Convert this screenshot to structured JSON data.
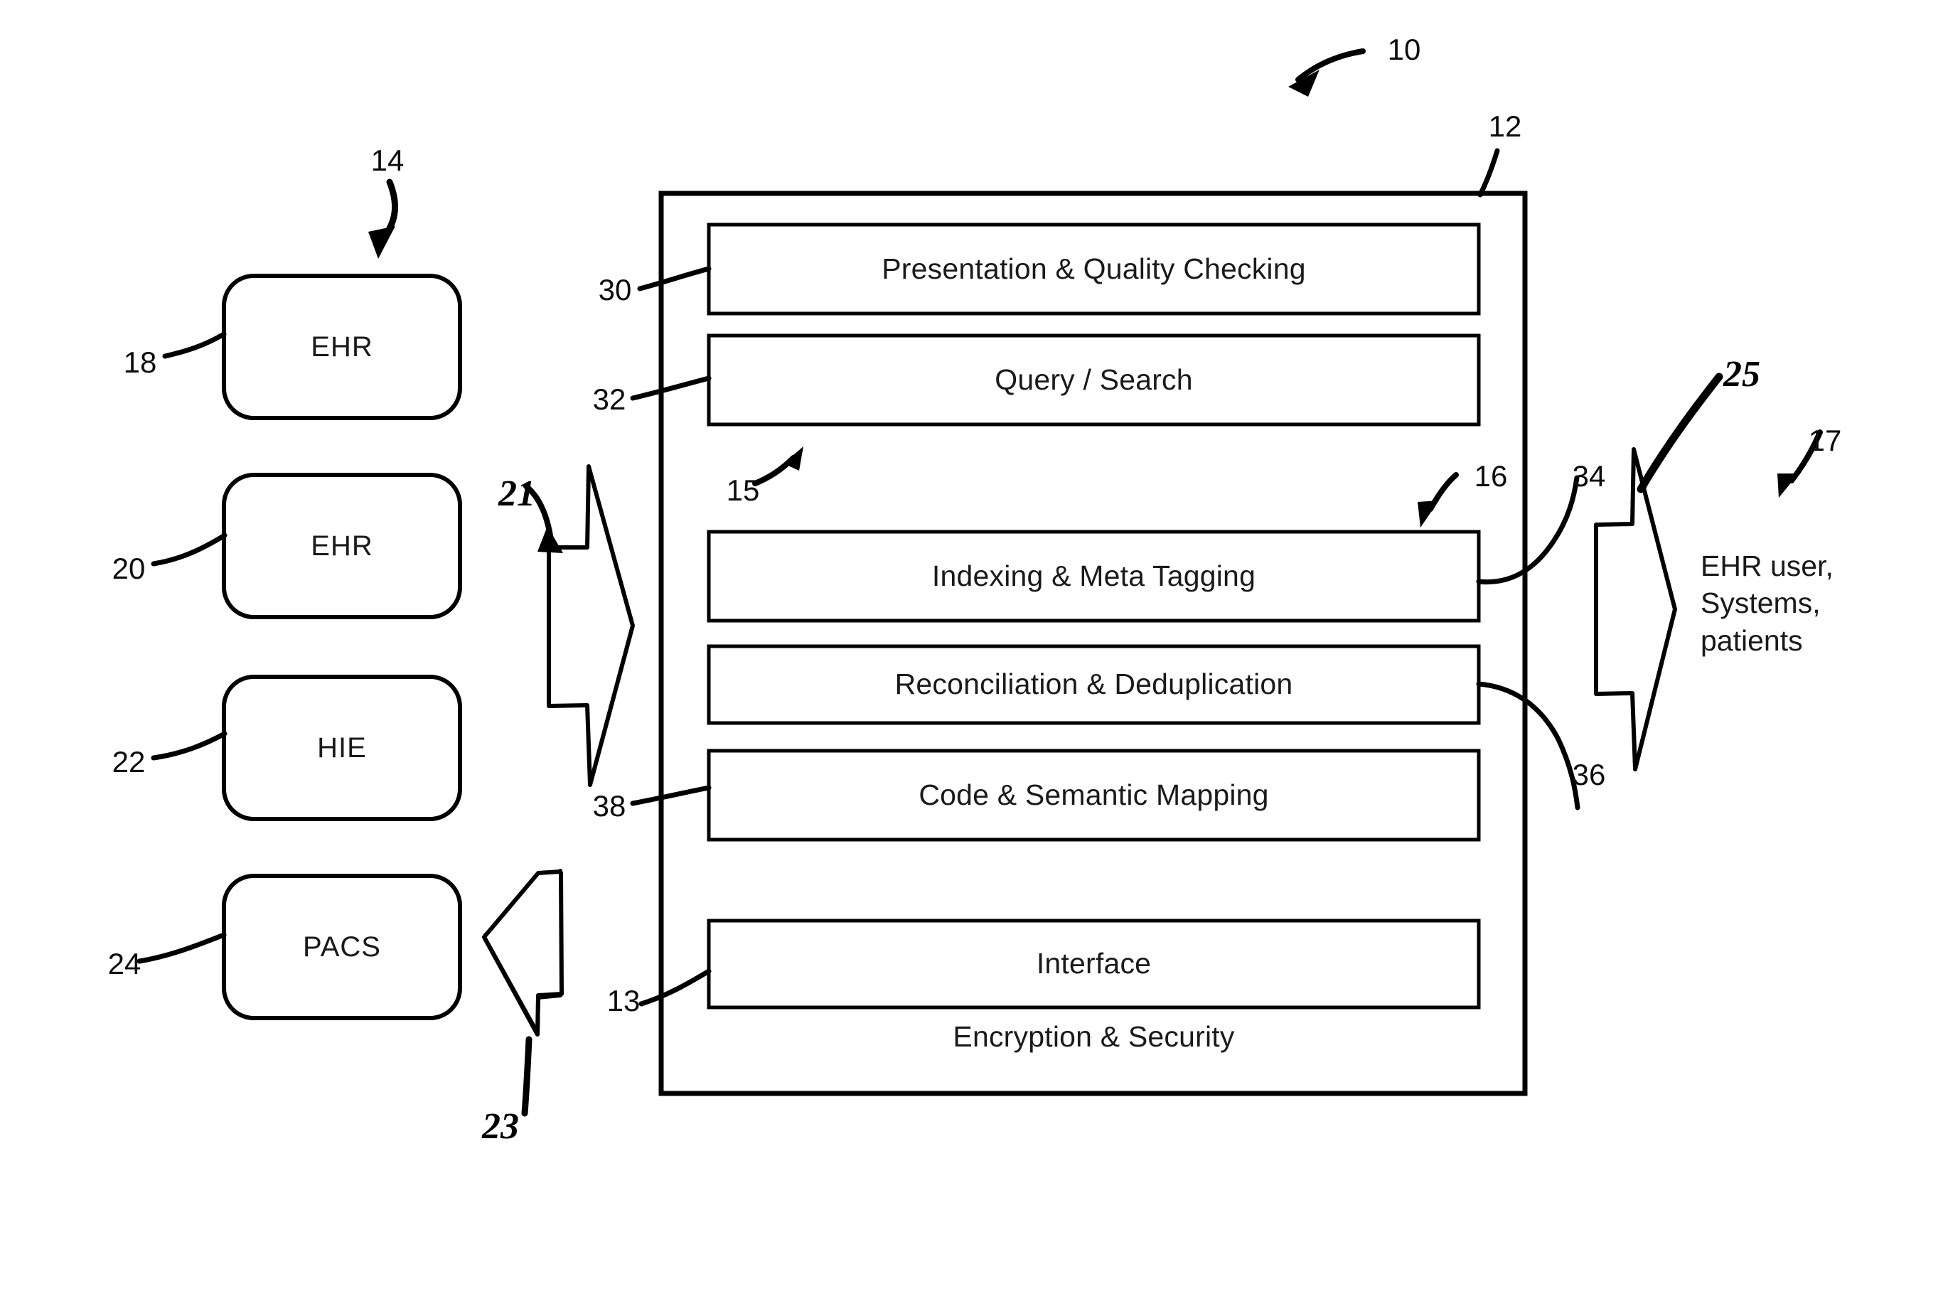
{
  "figure": {
    "type": "patent-block-diagram",
    "background": "#ffffff",
    "ink_color": "#000000"
  },
  "system": {
    "outer_box_ref": "12",
    "overall_ref": "10",
    "inner_container_ref": "15",
    "layers": [
      {
        "ref": "30",
        "label": "Presentation & Quality Checking"
      },
      {
        "ref": "32",
        "label": "Query / Search"
      },
      {
        "ref": "16",
        "label": "Indexing & Meta Tagging"
      },
      {
        "ref": "",
        "label": "Reconciliation & Deduplication"
      },
      {
        "ref": "38",
        "label": "Code & Semantic Mapping"
      },
      {
        "ref": "13",
        "label": "Interface"
      }
    ],
    "footer_label": "Encryption & Security",
    "right_refs": [
      {
        "ref": "34",
        "points_to": "Indexing & Meta Tagging"
      },
      {
        "ref": "36",
        "points_to": "Reconciliation & Deduplication"
      }
    ]
  },
  "sources": {
    "group_ref": "14",
    "items": [
      {
        "ref": "18",
        "label": "EHR"
      },
      {
        "ref": "20",
        "label": "EHR"
      },
      {
        "ref": "22",
        "label": "HIE"
      },
      {
        "ref": "24",
        "label": "PACS"
      }
    ]
  },
  "connectors": [
    {
      "ref": "21",
      "direction": "right",
      "style": "hand-drawn-block-arrow"
    },
    {
      "ref": "23",
      "direction": "left",
      "style": "hand-drawn-block-arrow"
    },
    {
      "ref": "25",
      "direction": "right",
      "style": "hand-drawn-block-arrow"
    }
  ],
  "consumers": {
    "ref": "17",
    "lines": [
      "EHR user,",
      "Systems,",
      "patients"
    ],
    "text": "EHR user, Systems, patients"
  },
  "ref_numbers": [
    "10",
    "12",
    "13",
    "14",
    "15",
    "16",
    "17",
    "18",
    "20",
    "21",
    "22",
    "23",
    "24",
    "25",
    "30",
    "32",
    "34",
    "36",
    "38"
  ]
}
